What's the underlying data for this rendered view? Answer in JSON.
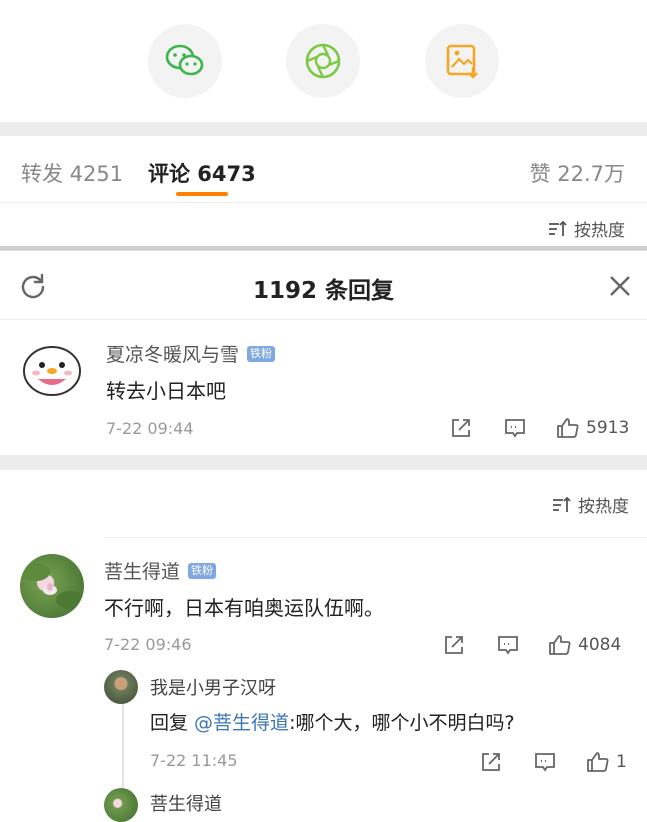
{
  "tabs": {
    "repost": "转发 4251",
    "comment": "评论 6473",
    "like": "赞 22.7万"
  },
  "sort_label": "按热度",
  "sheet": {
    "title": "1192 条回复",
    "root": {
      "user": "夏凉冬暖风与雪",
      "badge": "铁粉",
      "text": "转去小日本吧",
      "time": "7-22 09:44",
      "likes": "5913"
    }
  },
  "comments": [
    {
      "user": "菩生得道",
      "badge": "铁粉",
      "text": "不行啊，日本有咱奥运队伍啊。",
      "time": "7-22 09:46",
      "likes": "4084"
    }
  ],
  "reply": {
    "user": "我是小男子汉呀",
    "prefix": "回复 ",
    "mention": "@菩生得道",
    "text": ":哪个大，哪个小不明白吗?",
    "time": "7-22 11:45",
    "likes": "1"
  },
  "partial_user": "菩生得道",
  "colors": {
    "accent": "#ff8200",
    "wechat": "#39b54a",
    "moments": "#7ac943",
    "save": "#f5a623",
    "badge": "#7fa8e0"
  }
}
